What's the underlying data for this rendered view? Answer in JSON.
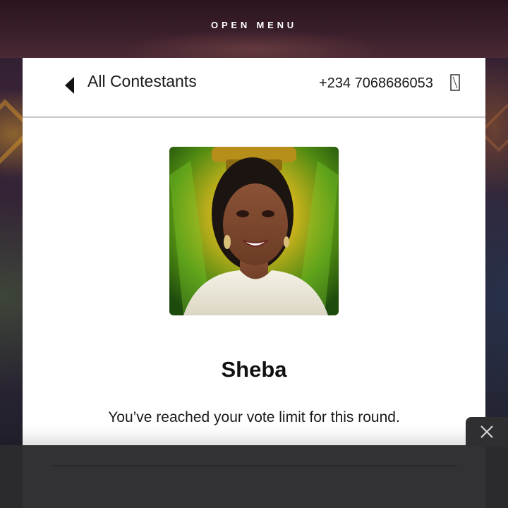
{
  "top_bar": {
    "menu_label": "OPEN MENU"
  },
  "header": {
    "back_label": "All Contestants",
    "phone": "+234 7068686053",
    "back_icon": "chevron-left-icon",
    "logout_icon": "logout-icon"
  },
  "contestant": {
    "name": "Sheba",
    "photo": "contestant-photo"
  },
  "message": {
    "text": "You’ve reached your vote limit for this round."
  },
  "overlay": {
    "close_icon": "close-icon"
  },
  "colors": {
    "modal_bg": "#ffffff",
    "text": "#1a1a1a",
    "overlay_bg": "#2b2b2d",
    "top_bar_bg": "#3b1f2c"
  }
}
